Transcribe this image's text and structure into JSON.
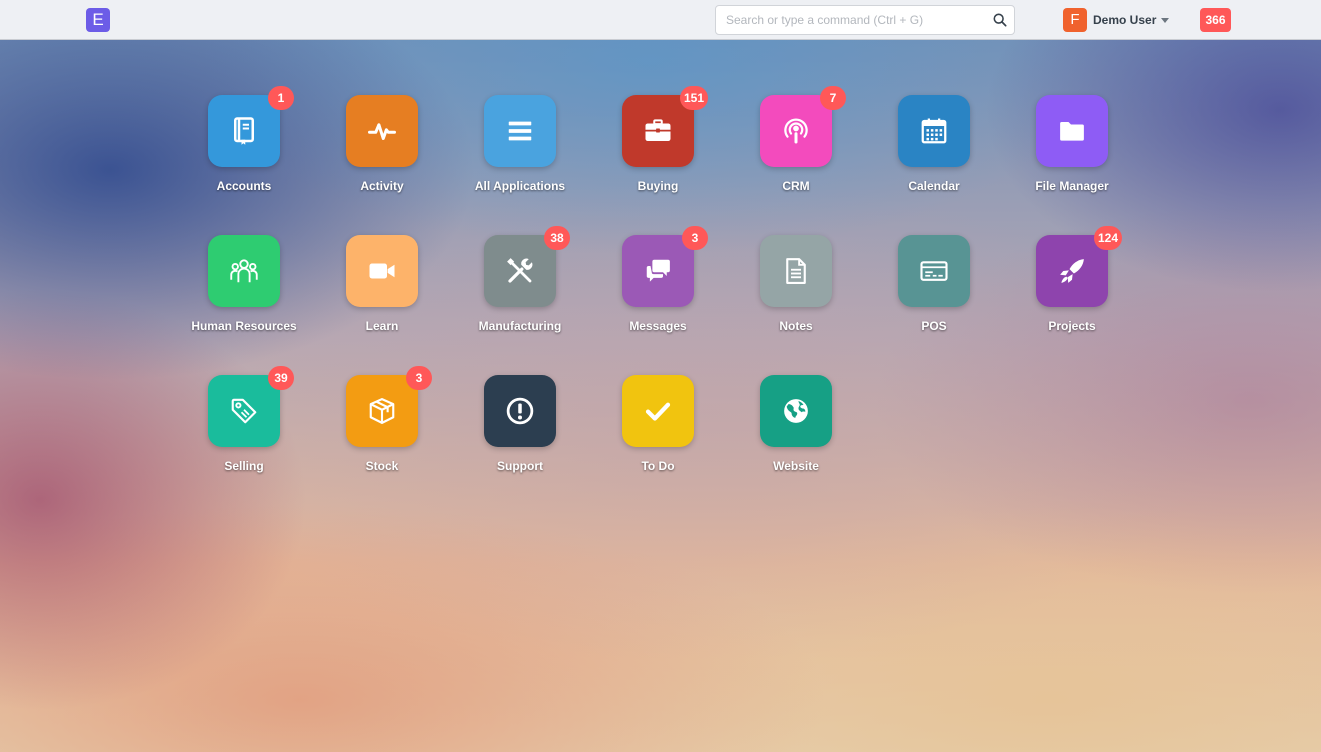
{
  "navbar": {
    "brand_letter": "E",
    "search": {
      "placeholder": "Search or type a command (Ctrl + G)",
      "value": ""
    },
    "user": {
      "avatar_letter": "F",
      "name": "Demo User"
    },
    "notifications_count": "366"
  },
  "apps": [
    {
      "label": "Accounts",
      "badge": "1",
      "color": "#3498db",
      "icon": "book-icon"
    },
    {
      "label": "Activity",
      "badge": "",
      "color": "#e67e22",
      "icon": "pulse-icon"
    },
    {
      "label": "All Applications",
      "badge": "",
      "color": "#4aa3df",
      "icon": "list-icon"
    },
    {
      "label": "Buying",
      "badge": "151",
      "color": "#c0392b",
      "icon": "briefcase-icon"
    },
    {
      "label": "CRM",
      "badge": "7",
      "color": "#f34bbd",
      "icon": "podcast-icon"
    },
    {
      "label": "Calendar",
      "badge": "",
      "color": "#2a84c4",
      "icon": "calendar-icon"
    },
    {
      "label": "File Manager",
      "badge": "",
      "color": "#8e5cf5",
      "icon": "folder-icon"
    },
    {
      "label": "Human Resources",
      "badge": "",
      "color": "#2ecc71",
      "icon": "people-icon"
    },
    {
      "label": "Learn",
      "badge": "",
      "color": "#fdb36a",
      "icon": "video-icon"
    },
    {
      "label": "Manufacturing",
      "badge": "38",
      "color": "#7f8c8d",
      "icon": "tools-icon"
    },
    {
      "label": "Messages",
      "badge": "3",
      "color": "#9b59b6",
      "icon": "chat-icon"
    },
    {
      "label": "Notes",
      "badge": "",
      "color": "#95a5a6",
      "icon": "document-icon"
    },
    {
      "label": "POS",
      "badge": "",
      "color": "#589494",
      "icon": "card-icon"
    },
    {
      "label": "Projects",
      "badge": "124",
      "color": "#8e44ad",
      "icon": "rocket-icon"
    },
    {
      "label": "Selling",
      "badge": "39",
      "color": "#1abc9c",
      "icon": "tag-icon"
    },
    {
      "label": "Stock",
      "badge": "3",
      "color": "#f39c12",
      "icon": "box-icon"
    },
    {
      "label": "Support",
      "badge": "",
      "color": "#2c3e50",
      "icon": "alert-icon"
    },
    {
      "label": "To Do",
      "badge": "",
      "color": "#f1c40f",
      "icon": "check-icon"
    },
    {
      "label": "Website",
      "badge": "",
      "color": "#16a085",
      "icon": "globe-icon"
    }
  ]
}
